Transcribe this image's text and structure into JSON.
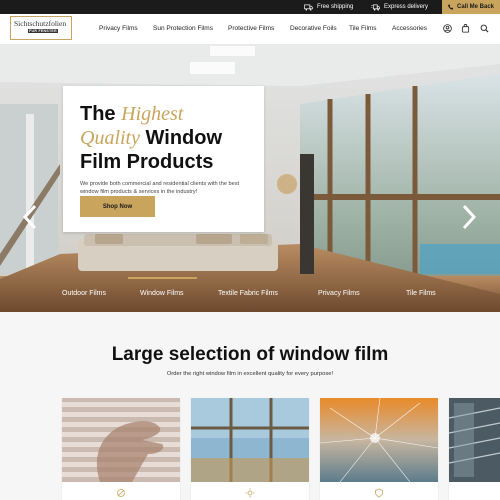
{
  "topbar": {
    "shipping_label": "Free shipping",
    "express_label": "Express delivery",
    "call_label": "Call Me Back"
  },
  "header": {
    "logo_main": "Sichtschutzfolien",
    "logo_sub": "FÜR FENSTER",
    "nav": [
      "Privacy Films",
      "Sun Protection Films",
      "Protective Films",
      "Decorative Foils",
      "Tile Films",
      "Accessories"
    ]
  },
  "hero": {
    "title_part1": "The ",
    "title_gold": "Highest Quality",
    "title_part2": " Window Film Products",
    "description": "We provide both commercial and residential clients with the best window film products & services in the industry!",
    "cta_label": "Shop Now",
    "categories": [
      "Outdoor Films",
      "Window Films",
      "Textile Fabric Films",
      "Privacy Films",
      "Tile Films"
    ],
    "active_category": "Window Films"
  },
  "section": {
    "title": "Large selection of window film",
    "subtitle": "Order the right window film in excellent quality for every purpose!"
  },
  "colors": {
    "accent": "#c9a45c",
    "topbar": "#1b1b1b",
    "section_bg": "#f6f6f6"
  },
  "icons": [
    "truck-icon",
    "delivery-icon",
    "phone-icon",
    "user-icon",
    "cart-icon",
    "search-icon",
    "arrow-left-icon",
    "arrow-right-icon"
  ]
}
